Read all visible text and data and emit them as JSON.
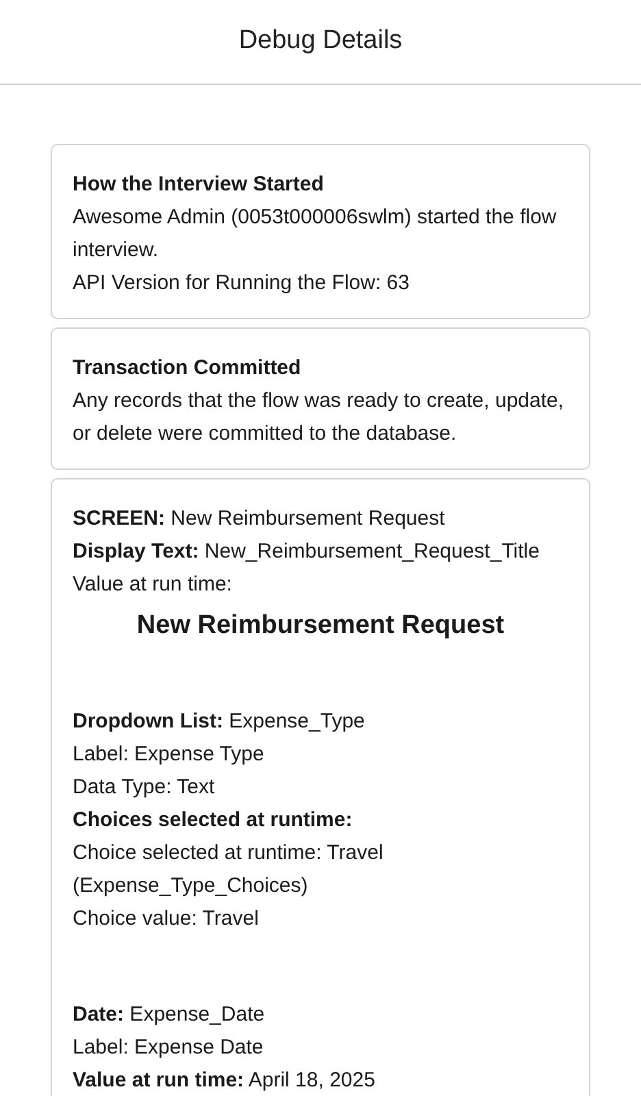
{
  "header": {
    "title": "Debug Details"
  },
  "sections": [
    {
      "kind": "info",
      "heading": "How the Interview Started",
      "lines": [
        "Awesome Admin (0053t000006swlm) started the flow interview.",
        "API Version for Running the Flow: 63"
      ]
    },
    {
      "kind": "info",
      "heading": "Transaction Committed",
      "lines": [
        "Any records that the flow was ready to create, update, or delete were committed to the database."
      ]
    },
    {
      "kind": "screen",
      "groups": [
        [
          {
            "kind": "text",
            "text": "**SCREEN:** New Reimbursement Request"
          },
          {
            "kind": "text",
            "text": "**Display Text:** New_Reimbursement_Request_Title"
          },
          {
            "kind": "text",
            "text": "Value at run time:"
          },
          {
            "kind": "display",
            "text": "New Reimbursement Request"
          }
        ],
        [
          {
            "kind": "text",
            "text": "**Dropdown List:** Expense_Type"
          },
          {
            "kind": "text",
            "text": "Label: Expense Type"
          },
          {
            "kind": "text",
            "text": "Data Type: Text"
          },
          {
            "kind": "subheading",
            "text": "Choices selected at runtime:"
          },
          {
            "kind": "text",
            "text": "Choice selected at runtime: Travel (Expense_Type_Choices)"
          },
          {
            "kind": "text",
            "text": "Choice value: Travel"
          }
        ],
        [
          {
            "kind": "text",
            "text": "**Date:** Expense_Date"
          },
          {
            "kind": "text",
            "text": "Label: Expense Date"
          },
          {
            "kind": "text",
            "text": "**Value at run time:** April 18, 2025"
          }
        ]
      ]
    }
  ]
}
